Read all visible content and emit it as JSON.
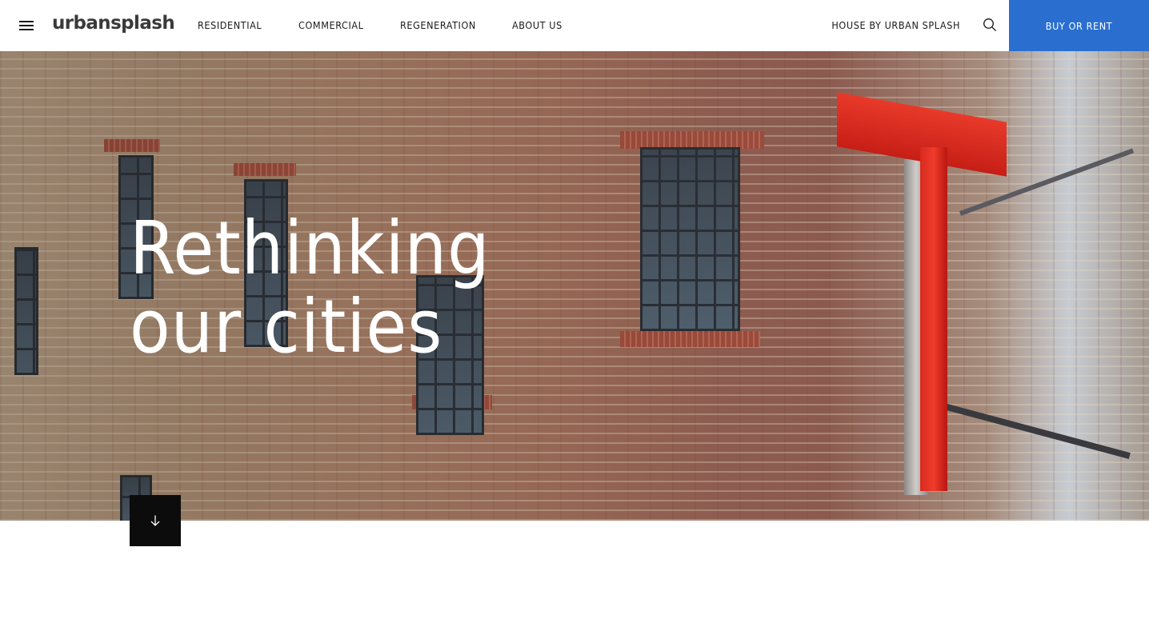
{
  "header": {
    "logo_text": "urbansplash",
    "nav": {
      "residential": "RESIDENTIAL",
      "commercial": "COMMERCIAL",
      "regeneration": "REGENERATION",
      "about": "ABOUT US"
    },
    "house_link": "HOUSE BY URBAN SPLASH",
    "cta_label": "BUY OR RENT",
    "cta_color": "#2a6fd0"
  },
  "hero": {
    "title_line1": "Rethinking",
    "title_line2": "our cities"
  },
  "icons": {
    "menu": "hamburger-icon",
    "search": "search-icon",
    "scroll": "arrow-down-icon"
  }
}
